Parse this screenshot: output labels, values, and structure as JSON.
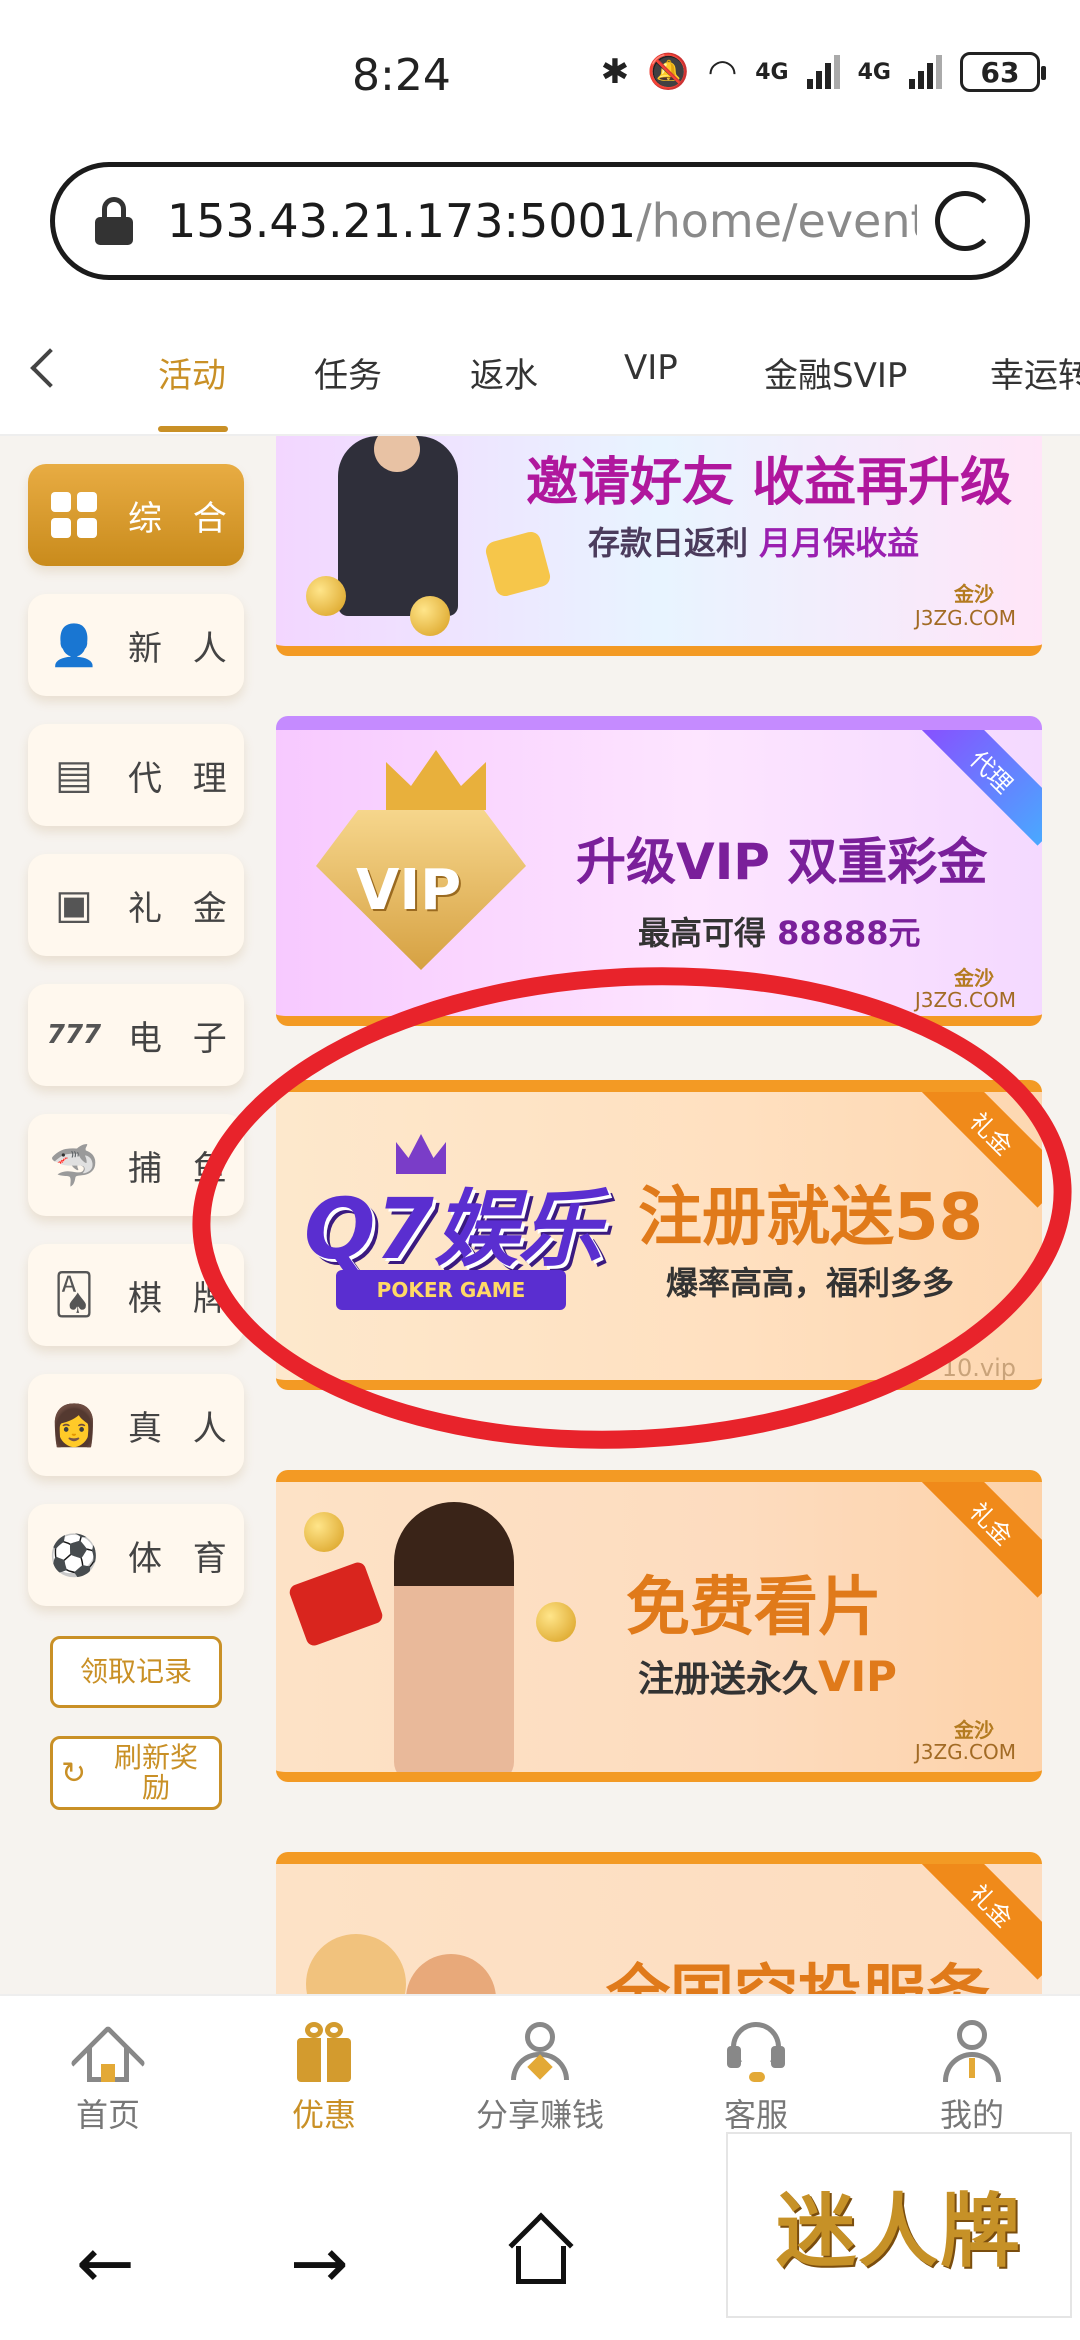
{
  "status_bar": {
    "time": "8:24",
    "signal_1": "4G",
    "signal_2": "4G",
    "battery": "63"
  },
  "browser": {
    "url_main": "153.43.21.173:5001",
    "url_path": "/home/event?e"
  },
  "top_tabs": [
    "活动",
    "任务",
    "返水",
    "VIP",
    "金融SVIP",
    "幸运转"
  ],
  "sidebar": {
    "items": [
      {
        "label": "综 合",
        "icon": "grid-icon"
      },
      {
        "label": "新 人",
        "icon": "person-icon"
      },
      {
        "label": "代 理",
        "icon": "cash-icon"
      },
      {
        "label": "礼 金",
        "icon": "wallet-icon"
      },
      {
        "label": "电 子",
        "icon": "slot-777-icon"
      },
      {
        "label": "捕 鱼",
        "icon": "shark-icon"
      },
      {
        "label": "棋 牌",
        "icon": "cards-icon"
      },
      {
        "label": "真 人",
        "icon": "woman-icon"
      },
      {
        "label": "体 育",
        "icon": "soccer-ball-icon"
      }
    ],
    "claim_records": "领取记录",
    "refresh_rewards_line1": "刷新奖",
    "refresh_rewards_line2": "励"
  },
  "banners": [
    {
      "title": "邀请好友 收益再升级",
      "subtitle_a": "存款日返利",
      "subtitle_b": "月月保收益",
      "brand": "金沙",
      "domain": "J3ZG.COM"
    },
    {
      "tag": "代理",
      "badge": "VIP",
      "title": "升级VIP 双重彩金",
      "subtitle_a": "最高可得",
      "subtitle_b": "88888元",
      "brand": "金沙",
      "domain": "J3ZG.COM"
    },
    {
      "tag": "礼金",
      "logo_main": "Q7娱乐",
      "logo_ribbon": "POKER GAME",
      "title": "注册就送58",
      "subtitle": "爆率高高，福利多多",
      "domain": "10.vip"
    },
    {
      "tag": "礼金",
      "title": "免费看片",
      "subtitle_a": "注册送永久",
      "subtitle_b": "VIP",
      "brand": "金沙",
      "domain": "J3ZG.COM"
    },
    {
      "tag": "礼金",
      "title": "全国空投服务"
    }
  ],
  "bottom_tabs": [
    {
      "label": "首页",
      "icon": "home-icon"
    },
    {
      "label": "优惠",
      "icon": "gift-icon"
    },
    {
      "label": "分享赚钱",
      "icon": "share-people-icon"
    },
    {
      "label": "客服",
      "icon": "headset-icon"
    },
    {
      "label": "我的",
      "icon": "user-icon"
    }
  ],
  "watermark": "迷人牌",
  "colors": {
    "accent": "#c99026",
    "banner_orange": "#f39a24",
    "annotation_red": "#e8232b"
  }
}
